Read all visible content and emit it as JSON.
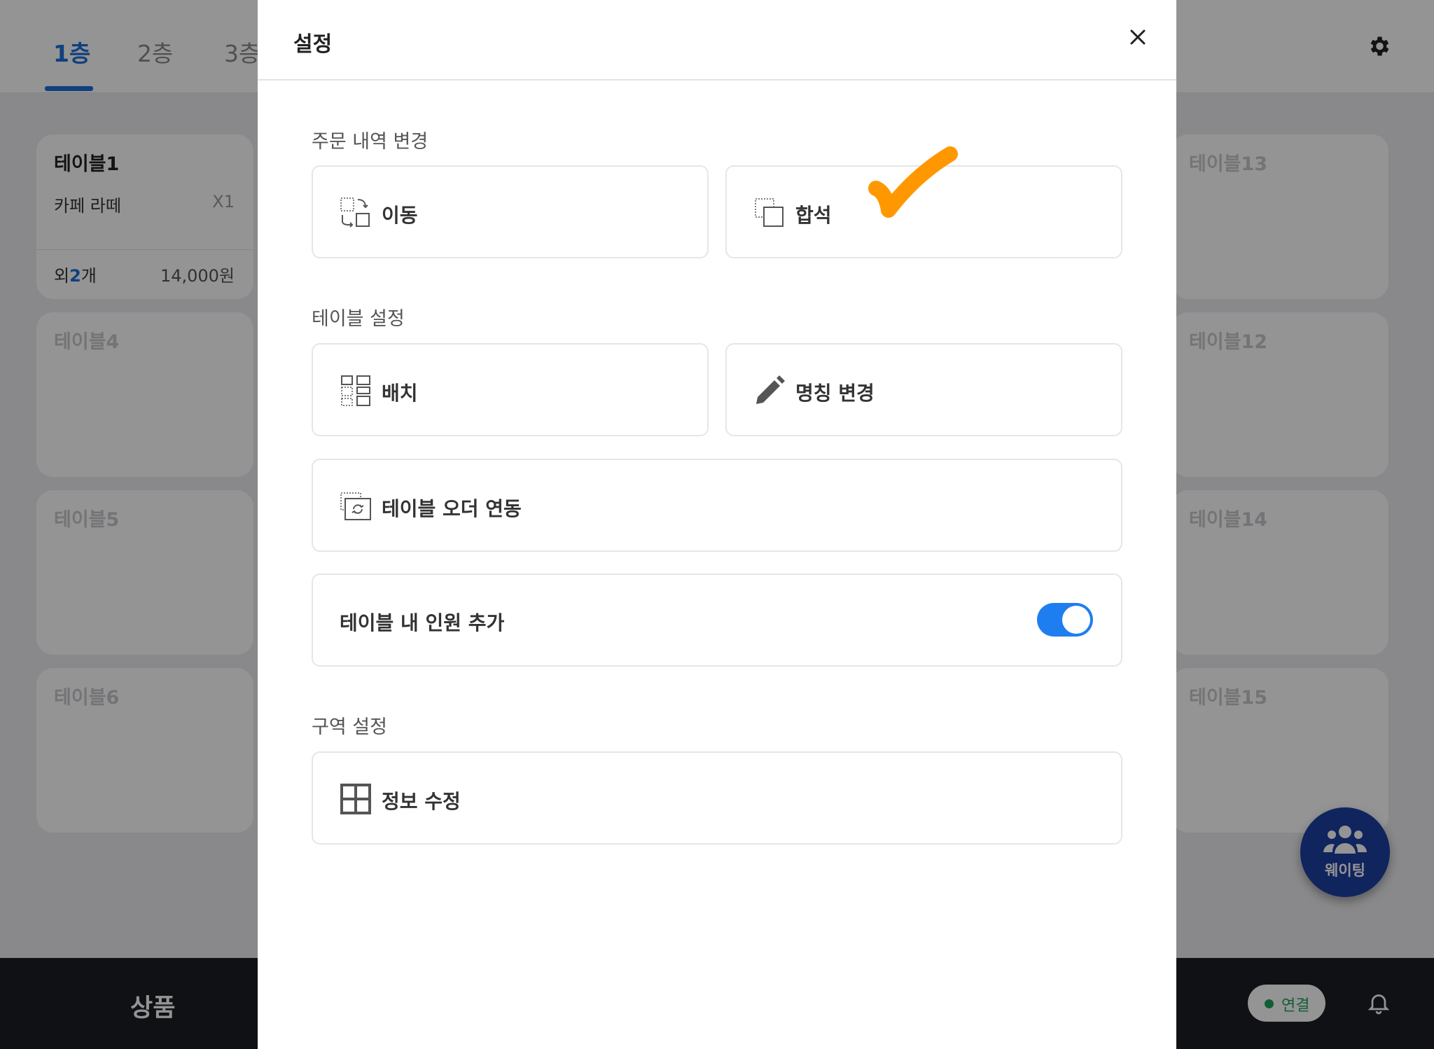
{
  "floors": {
    "tabs": [
      {
        "label": "1층"
      },
      {
        "label": "2층"
      },
      {
        "label": "3층"
      }
    ]
  },
  "tables": {
    "table1": {
      "name": "테이블1",
      "item": "카페 라떼",
      "qty": "X1",
      "more_prefix": "외",
      "more_count": "2",
      "more_suffix": "개",
      "price": "14,000원"
    },
    "table4": {
      "name": "테이블4"
    },
    "table5": {
      "name": "테이블5"
    },
    "table6": {
      "name": "테이블6"
    },
    "table13": {
      "name": "테이블13"
    },
    "table12": {
      "name": "테이블12"
    },
    "table14": {
      "name": "테이블14"
    },
    "table15": {
      "name": "테이블15"
    }
  },
  "bottom": {
    "product_label": "상품",
    "connection_label": "연결"
  },
  "waiting": {
    "label": "웨이팅"
  },
  "modal": {
    "title": "설정",
    "sections": {
      "order_change": "주문 내역 변경",
      "table_settings": "테이블 설정",
      "zone_settings": "구역 설정"
    },
    "options": {
      "move": "이동",
      "merge": "합석",
      "layout": "배치",
      "rename": "명칭 변경",
      "table_order_link": "테이블 오더 연동",
      "add_guests": "테이블 내 인원 추가",
      "edit_info": "정보 수정"
    },
    "add_guests_toggle_on": true
  },
  "colors": {
    "accent": "#1e6fd9",
    "toggle": "#1e7ef0",
    "annotation": "#ff9800",
    "connection": "#1fa35b",
    "waiting_button": "#1d3fa3"
  },
  "icons": {
    "move": "move-icon",
    "merge": "merge-icon",
    "layout": "layout-grid-icon",
    "rename": "pencil-icon",
    "table_order_link": "sync-icon",
    "edit_info": "grid-icon",
    "settings": "gear-icon",
    "close": "close-icon",
    "bell": "bell-icon",
    "waiting": "people-icon",
    "annotation": "checkmark-icon"
  }
}
